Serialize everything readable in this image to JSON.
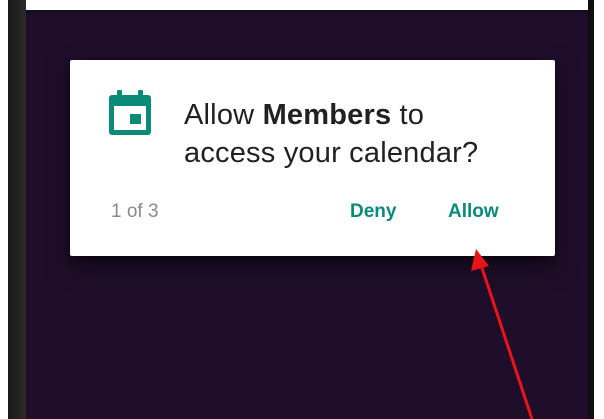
{
  "dialog": {
    "icon": "calendar-icon",
    "message_prefix": "Allow ",
    "app_name": "Members",
    "message_suffix_line1": " to",
    "message_line2": "access your calendar?",
    "counter": "1 of 3",
    "deny_label": "Deny",
    "allow_label": "Allow"
  },
  "colors": {
    "screen_background": "#1f0e2a",
    "accent": "#0b8a7a",
    "arrow": "#e8141a"
  },
  "annotation": {
    "arrow": "red-arrow-pointing-to-allow"
  }
}
